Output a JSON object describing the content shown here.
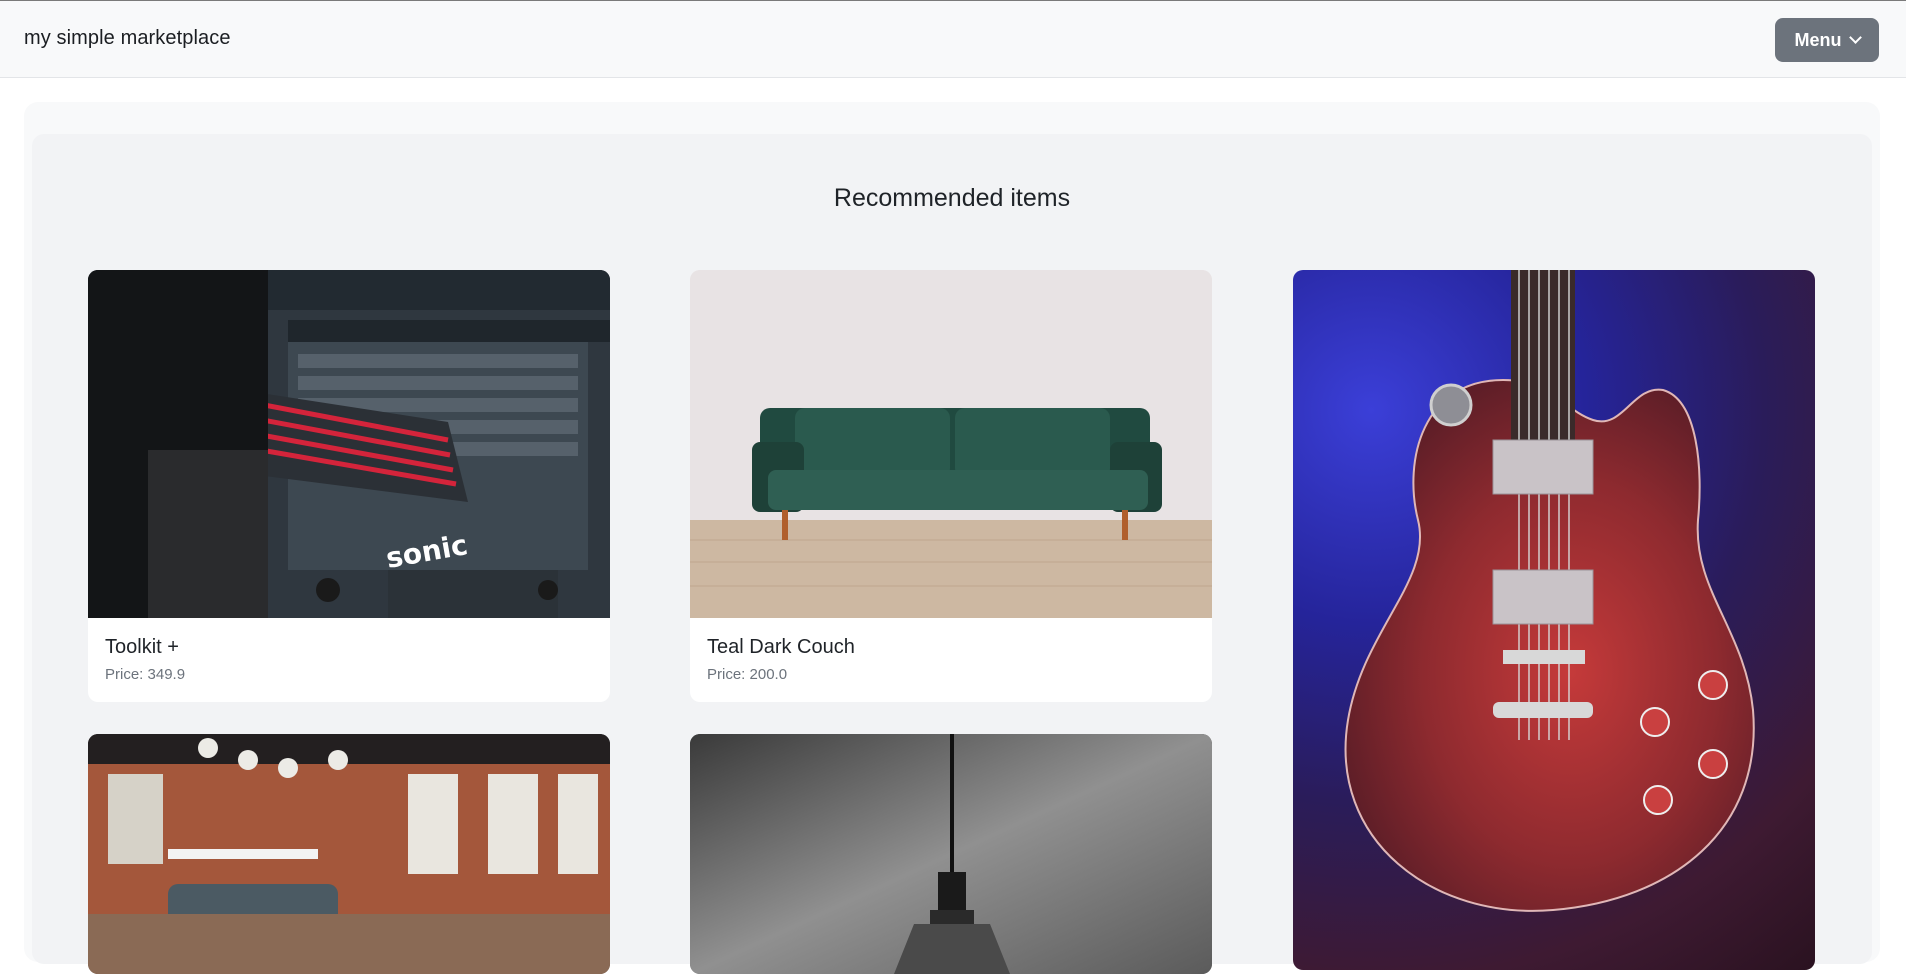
{
  "header": {
    "brand": "my simple marketplace",
    "menu_label": "Menu"
  },
  "section": {
    "title": "Recommended items"
  },
  "items": [
    {
      "name": "Toolkit +",
      "price": "Price: 349.9",
      "image": "toolkit-cart-photo"
    },
    {
      "name": "Teal Dark Couch",
      "price": "Price: 200.0",
      "image": "teal-couch-photo"
    },
    {
      "name": "",
      "price": "",
      "image": "red-electric-guitar-photo"
    },
    {
      "name": "",
      "price": "",
      "image": "loft-office-lounge-photo"
    },
    {
      "name": "",
      "price": "",
      "image": "pendant-lamp-photo"
    }
  ],
  "colors": {
    "menu_button": "#6c737c",
    "panel": "#f2f3f5",
    "header_bg": "#f8f9fa",
    "price_text": "#6c737c"
  }
}
